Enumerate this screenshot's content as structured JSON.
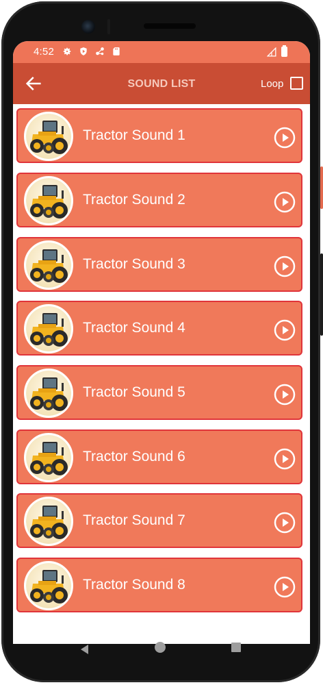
{
  "status_bar": {
    "time": "4:52",
    "icons": [
      "settings-icon",
      "shield-icon",
      "network-icon",
      "sd-card-icon"
    ],
    "right_icons": [
      "signal-icon",
      "battery-icon"
    ]
  },
  "app_bar": {
    "title": "SOUND LIST",
    "loop_label": "Loop",
    "loop_checked": false,
    "back_icon": "arrow-left-icon"
  },
  "sounds": [
    {
      "title": "Tractor Sound 1"
    },
    {
      "title": "Tractor Sound 2"
    },
    {
      "title": "Tractor Sound 3"
    },
    {
      "title": "Tractor Sound 4"
    },
    {
      "title": "Tractor Sound 5"
    },
    {
      "title": "Tractor Sound 6"
    },
    {
      "title": "Tractor Sound 7"
    },
    {
      "title": "Tractor Sound 8"
    }
  ],
  "nav_bar": {
    "icons": [
      "back-triangle-icon",
      "home-circle-icon",
      "recents-square-icon"
    ]
  },
  "colors": {
    "status_bar": "#ee7457",
    "app_bar": "#c94d34",
    "card": "#f0795a",
    "card_border": "#e0343a"
  }
}
